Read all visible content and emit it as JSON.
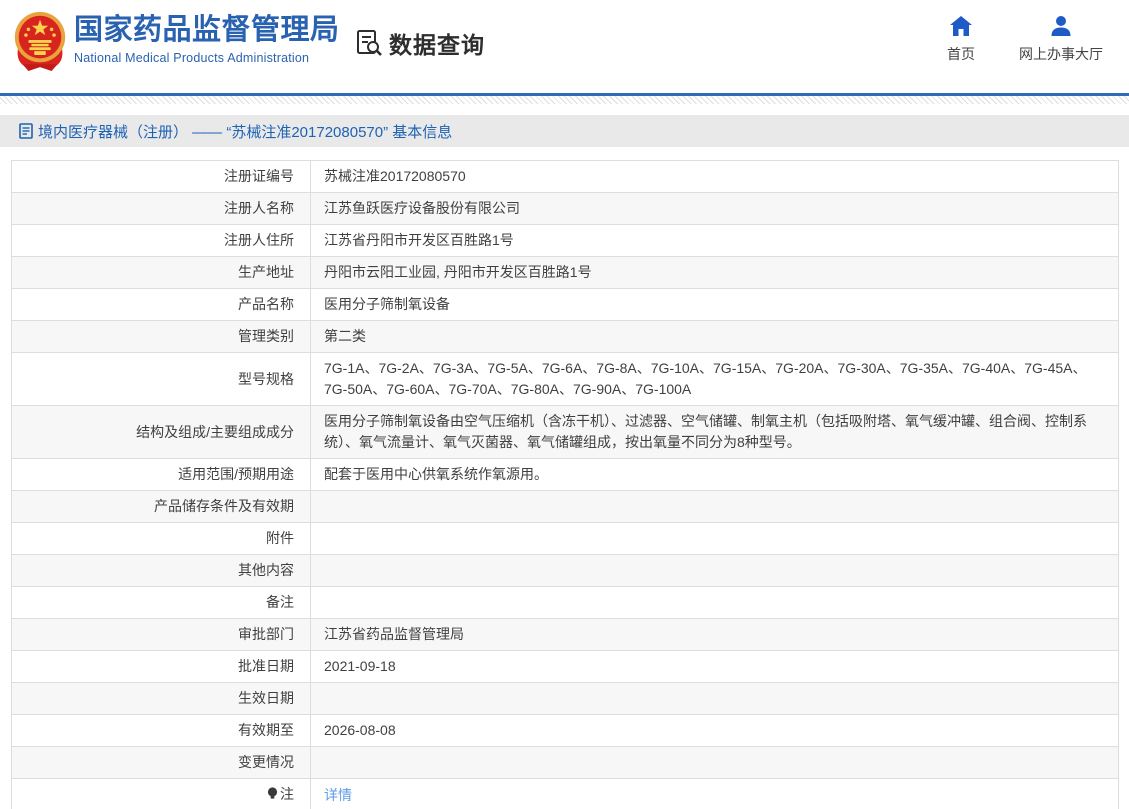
{
  "header": {
    "org_name_cn": "国家药品监督管理局",
    "org_name_en": "National Medical Products Administration",
    "section_title": "数据查询",
    "nav": [
      {
        "label": "首页",
        "icon": "home-icon"
      },
      {
        "label": "网上办事大厅",
        "icon": "user-icon"
      }
    ]
  },
  "breadcrumb": {
    "text": "境内医疗器械（注册） —— “苏械注准20172080570” 基本信息"
  },
  "table": {
    "rows": [
      {
        "label": "注册证编号",
        "value": "苏械注准20172080570"
      },
      {
        "label": "注册人名称",
        "value": "江苏鱼跃医疗设备股份有限公司"
      },
      {
        "label": "注册人住所",
        "value": "江苏省丹阳市开发区百胜路1号"
      },
      {
        "label": "生产地址",
        "value": "丹阳市云阳工业园, 丹阳市开发区百胜路1号"
      },
      {
        "label": "产品名称",
        "value": "医用分子筛制氧设备"
      },
      {
        "label": "管理类别",
        "value": "第二类"
      },
      {
        "label": "型号规格",
        "value": "7G-1A、7G-2A、7G-3A、7G-5A、7G-6A、7G-8A、7G-10A、7G-15A、7G-20A、7G-30A、7G-35A、7G-40A、7G-45A、7G-50A、7G-60A、7G-70A、7G-80A、7G-90A、7G-100A"
      },
      {
        "label": "结构及组成/主要组成成分",
        "value": "医用分子筛制氧设备由空气压缩机（含冻干机）、过滤器、空气储罐、制氧主机（包括吸附塔、氧气缓冲罐、组合阀、控制系统）、氧气流量计、氧气灭菌器、氧气储罐组成，按出氧量不同分为8种型号。"
      },
      {
        "label": "适用范围/预期用途",
        "value": "配套于医用中心供氧系统作氧源用。"
      },
      {
        "label": "产品储存条件及有效期",
        "value": ""
      },
      {
        "label": "附件",
        "value": ""
      },
      {
        "label": "其他内容",
        "value": ""
      },
      {
        "label": "备注",
        "value": ""
      },
      {
        "label": "审批部门",
        "value": "江苏省药品监督管理局"
      },
      {
        "label": "批准日期",
        "value": "2021-09-18"
      },
      {
        "label": "生效日期",
        "value": ""
      },
      {
        "label": "有效期至",
        "value": "2026-08-08"
      },
      {
        "label": "变更情况",
        "value": ""
      },
      {
        "label": "注",
        "label_icon": "bulb-icon",
        "value": "详情",
        "value_is_link": true
      }
    ]
  },
  "colors": {
    "brand_blue": "#2a62b2",
    "nav_icon_blue": "#1e5bc6",
    "divider_blue": "#2e6cb8",
    "breadcrumb_text": "#1e62b4",
    "breadcrumb_bg": "#e9e9e9",
    "link_blue": "#5f9be8",
    "row_alt_bg": "#f7f7f7"
  }
}
